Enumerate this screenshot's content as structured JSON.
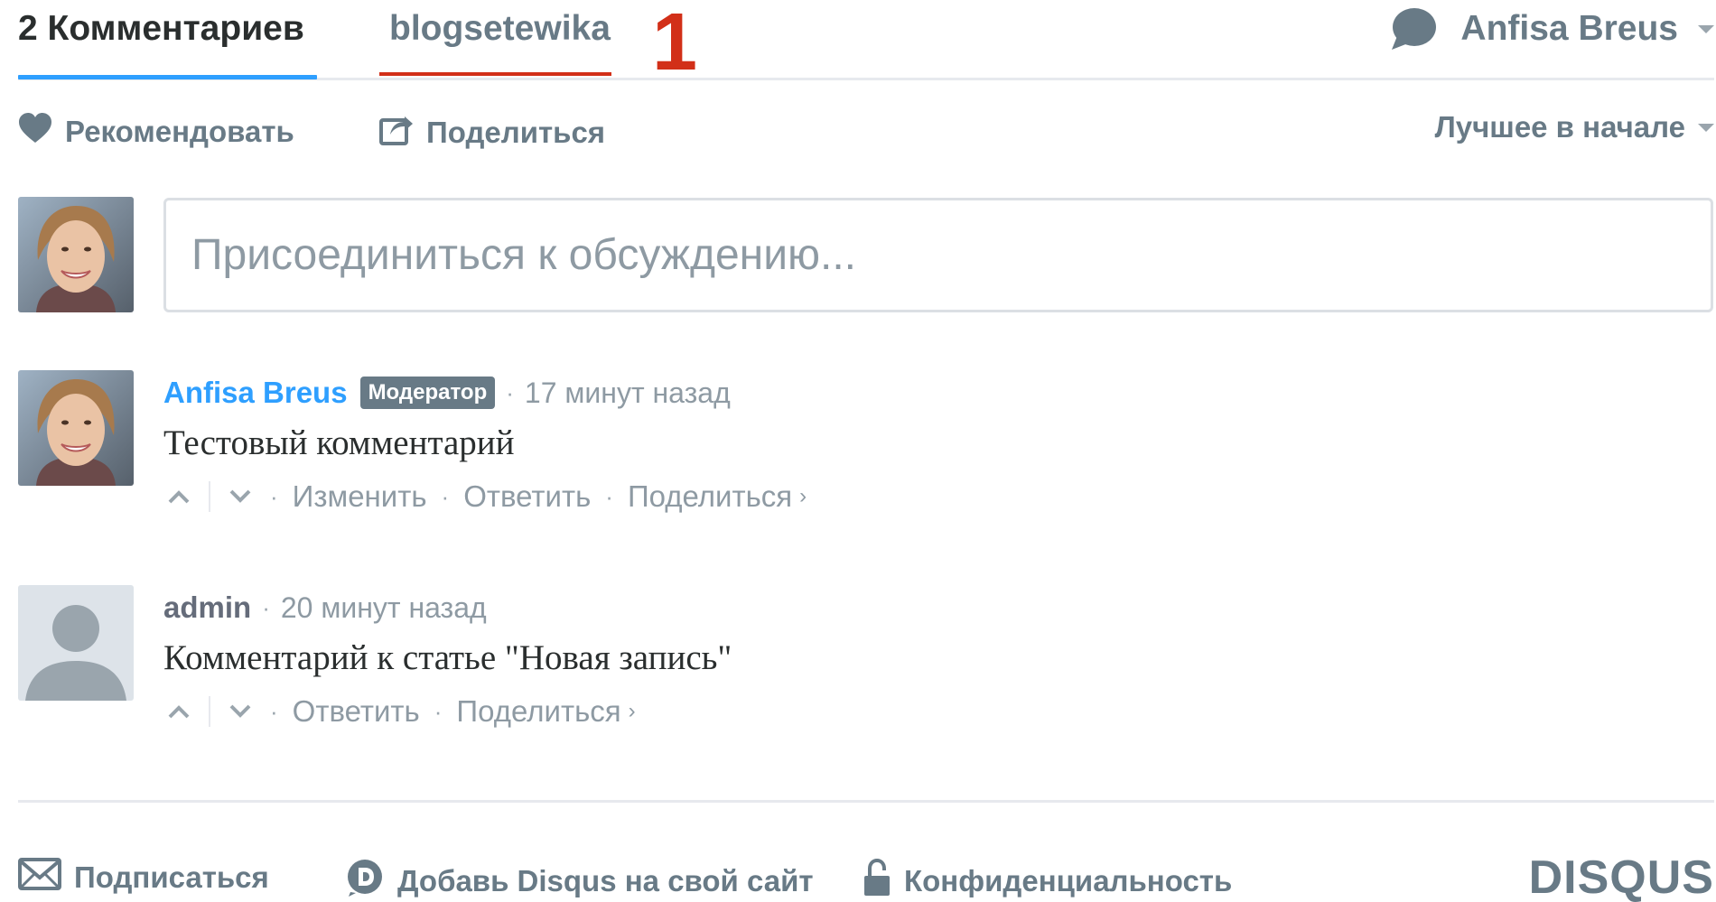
{
  "nav": {
    "comments_tab": "2 Комментариев",
    "forum_tab": "blogsetewika",
    "annotation": "1",
    "user_name": "Anfisa Breus"
  },
  "actions": {
    "recommend": "Рекомендовать",
    "share": "Поделиться",
    "sort": "Лучшее в начале"
  },
  "compose": {
    "placeholder": "Присоединиться к обсуждению..."
  },
  "comments": [
    {
      "author": "Anfisa Breus",
      "badge": "Модератор",
      "time": "17 минут назад",
      "text": "Тестовый комментарий",
      "links": [
        "Изменить",
        "Ответить",
        "Поделиться"
      ]
    },
    {
      "author": "admin",
      "time": "20 минут назад",
      "text": "Комментарий к статье \"Новая запись\"",
      "links": [
        "Ответить",
        "Поделиться"
      ]
    }
  ],
  "footer": {
    "subscribe": "Подписаться",
    "add_disqus": "Добавь Disqus на свой сайт",
    "privacy": "Конфиденциальность",
    "logo": "DISQUS"
  },
  "colors": {
    "accent_blue": "#2e9fff",
    "annotation_red": "#d22f18",
    "muted": "#687a86"
  },
  "icons": {
    "heart": "heart-icon",
    "share": "share-icon",
    "bubble": "chat-bubble-icon",
    "mail": "mail-icon",
    "disqus": "disqus-d-icon",
    "lock": "lock-icon",
    "upvote": "chevron-up-icon",
    "downvote": "chevron-down-icon"
  }
}
